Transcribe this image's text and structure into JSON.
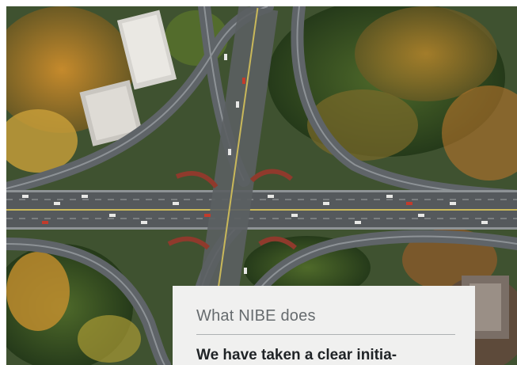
{
  "photo": {
    "subject": "aerial view of a multi-level highway interchange surrounded by autumn trees and buildings",
    "icon": "highway-interchange-photo"
  },
  "card": {
    "title": "What NIBE does",
    "text": "We have taken a clear initia-"
  },
  "colors": {
    "card_background": "#f0f0ef",
    "title_text": "#666b6e",
    "body_text": "#1f2326",
    "divider": "#aeb1b3"
  }
}
